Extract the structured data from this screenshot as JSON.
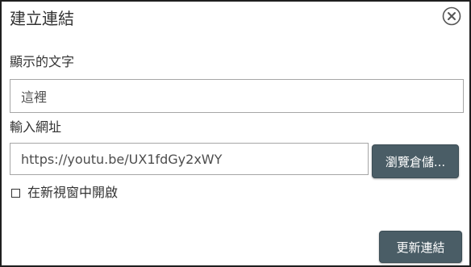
{
  "dialog": {
    "title": "建立連結",
    "close_icon": "close-circle-icon"
  },
  "display_text": {
    "label": "顯示的文字",
    "value": "這裡"
  },
  "url": {
    "label": "輸入網址",
    "value": "https://youtu.be/UX1fdGy2xWY"
  },
  "browse_button": {
    "label": "瀏覽倉儲..."
  },
  "new_window": {
    "label": "在新視窗中開啟",
    "checked": false
  },
  "update_button": {
    "label": "更新連結"
  },
  "colors": {
    "button_bg": "#4a5d66",
    "button_text": "#ffffff",
    "text": "#333333",
    "input_border": "#a6a6a6"
  }
}
